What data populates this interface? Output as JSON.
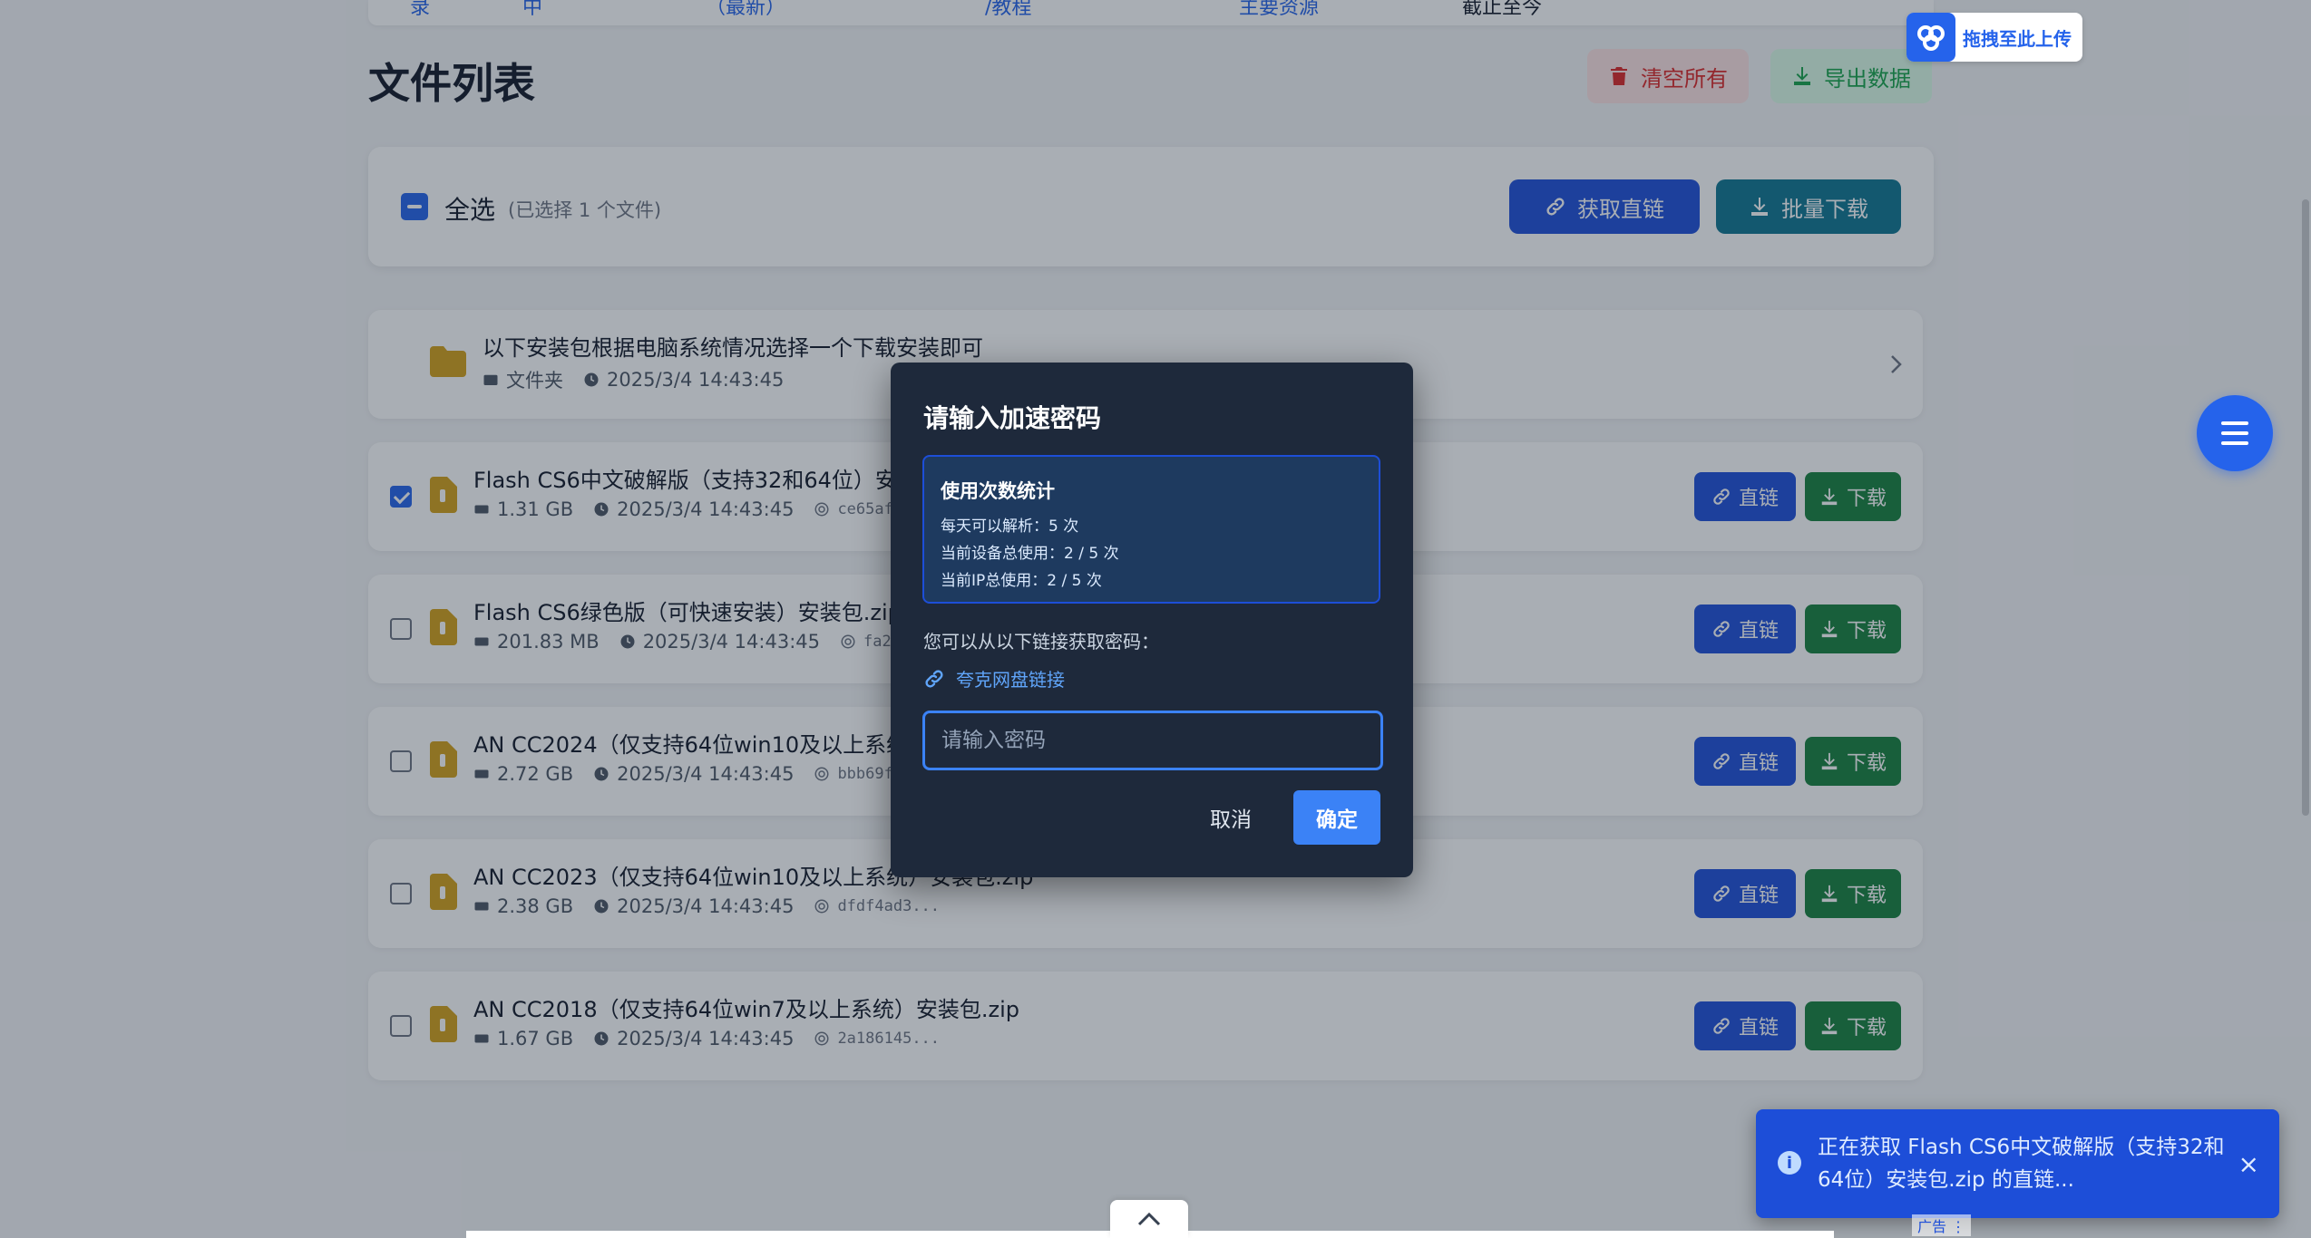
{
  "nav": {
    "items": [
      "录",
      "中",
      "（最新）",
      "/教程",
      "主要资源",
      "截止至今"
    ]
  },
  "header": {
    "title": "文件列表",
    "clear_label": "清空所有",
    "export_label": "导出数据"
  },
  "toolbar": {
    "select_all_label": "全选",
    "selected_count": "(已选择 1 个文件)",
    "get_links_label": "获取直链",
    "batch_download_label": "批量下载"
  },
  "files": [
    {
      "name": "以下安装包根据电脑系统情况选择一个下载安装即可",
      "type_label": "文件夹",
      "time": "2025/3/4 14:43:45",
      "is_folder": true
    },
    {
      "name": "Flash CS6中文破解版（支持32和64位）安装包.zip",
      "size": "1.31 GB",
      "time": "2025/3/4 14:43:45",
      "hash": "ce65af59...",
      "checked": true
    },
    {
      "name": "Flash CS6绿色版（可快速安装）安装包.zip",
      "size": "201.83 MB",
      "time": "2025/3/4 14:43:45",
      "hash": "fa2b117..."
    },
    {
      "name": "AN CC2024（仅支持64位win10及以上系统）安装包.zip",
      "size": "2.72 GB",
      "time": "2025/3/4 14:43:45",
      "hash": "bbb69f4b..."
    },
    {
      "name": "AN CC2023（仅支持64位win10及以上系统）安装包.zip",
      "size": "2.38 GB",
      "time": "2025/3/4 14:43:45",
      "hash": "dfdf4ad3..."
    },
    {
      "name": "AN CC2018（仅支持64位win7及以上系统）安装包.zip",
      "size": "1.67 GB",
      "time": "2025/3/4 14:43:45",
      "hash": "2a186145..."
    }
  ],
  "row_actions": {
    "direct_label": "直链",
    "download_label": "下载"
  },
  "upload_badge": {
    "label": "拖拽至此上传"
  },
  "modal": {
    "title": "请输入加速密码",
    "stats_title": "使用次数统计",
    "stats_daily": "每天可以解析：5 次",
    "stats_device": "当前设备总使用：2 / 5 次",
    "stats_ip": "当前IP总使用：2 / 5 次",
    "hint": "您可以从以下链接获取密码：",
    "link_label": "夸克网盘链接",
    "input_placeholder": "请输入密码",
    "cancel_label": "取消",
    "ok_label": "确定"
  },
  "toast": {
    "message": "正在获取 Flash CS6中文破解版（支持32和64位）安装包.zip 的直链...",
    "close": "×"
  },
  "ad_label": "广告 ⋮",
  "colors": {
    "primary": "#2563eb",
    "success": "#15803d",
    "danger": "#dc2626",
    "modal_bg": "#1e293b"
  }
}
